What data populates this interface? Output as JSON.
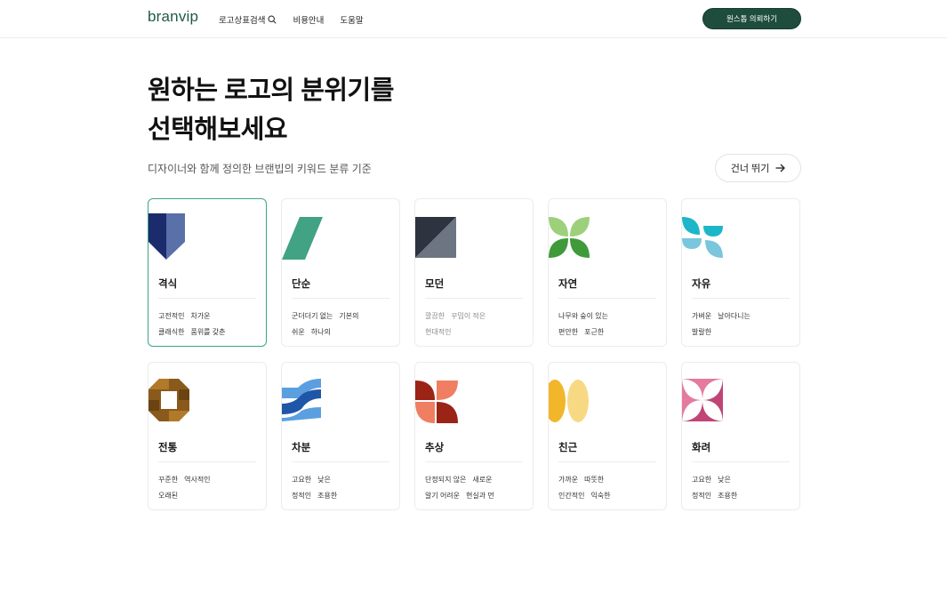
{
  "header": {
    "logo": "branvip",
    "nav": [
      {
        "label": "로고상표검색",
        "icon": "search-icon"
      },
      {
        "label": "비용안내"
      },
      {
        "label": "도움말"
      }
    ],
    "cta_label": "원스톱 의뢰하기"
  },
  "hero": {
    "title_line1": "원하는 로고의 분위기를",
    "title_line2": "선택해보세요",
    "subtitle": "디자이너와 함께 정의한 브랜빕의 키워드 분류 기준",
    "skip_label": "건너 뛰기",
    "skip_icon": "arrow-right-icon"
  },
  "styles": [
    {
      "name": "격식",
      "icon": "formal-shield-icon",
      "selected": true,
      "tags": [
        [
          "고전적인",
          "차가운"
        ],
        [
          "클래식한",
          "품위를 갖춘"
        ]
      ]
    },
    {
      "name": "단순",
      "icon": "simple-parallelogram-icon",
      "tags": [
        [
          "군더더기 없는",
          "기본의"
        ],
        [
          "쉬운",
          "하나의"
        ]
      ]
    },
    {
      "name": "모던",
      "icon": "modern-diagonal-square-icon",
      "muted": true,
      "tags": [
        [
          "깔끔한",
          "꾸밈이 적은"
        ],
        [
          "현대적인"
        ]
      ]
    },
    {
      "name": "자연",
      "icon": "nature-leaves-icon",
      "tags": [
        [
          "나무와 숲이 있는"
        ],
        [
          "편안한",
          "포근한"
        ]
      ]
    },
    {
      "name": "자유",
      "icon": "freedom-pinwheel-icon",
      "tags": [
        [
          "가벼운",
          "날아다니는"
        ],
        [
          "발랄한"
        ]
      ]
    },
    {
      "name": "전통",
      "icon": "tradition-octagon-icon",
      "tags": [
        [
          "꾸준한",
          "역사적인"
        ],
        [
          "오래된"
        ]
      ]
    },
    {
      "name": "차분",
      "icon": "calm-waves-icon",
      "tags": [
        [
          "고요한",
          "낮은"
        ],
        [
          "정적인",
          "조용한"
        ]
      ]
    },
    {
      "name": "추상",
      "icon": "abstract-shapes-icon",
      "tags": [
        [
          "단정되지 않은",
          "새로운"
        ],
        [
          "알기 어려운",
          "현실과 먼"
        ]
      ]
    },
    {
      "name": "친근",
      "icon": "friendly-ovals-icon",
      "tags": [
        [
          "가까운",
          "따뜻한"
        ],
        [
          "인간적인",
          "익숙한"
        ]
      ]
    },
    {
      "name": "화려",
      "icon": "fancy-star-icon",
      "tags": [
        [
          "고요한",
          "낮은"
        ],
        [
          "정적인",
          "조용한"
        ]
      ]
    }
  ],
  "colors": {
    "brand": "#1f4d3d",
    "selected_border": "#3aa58a"
  }
}
